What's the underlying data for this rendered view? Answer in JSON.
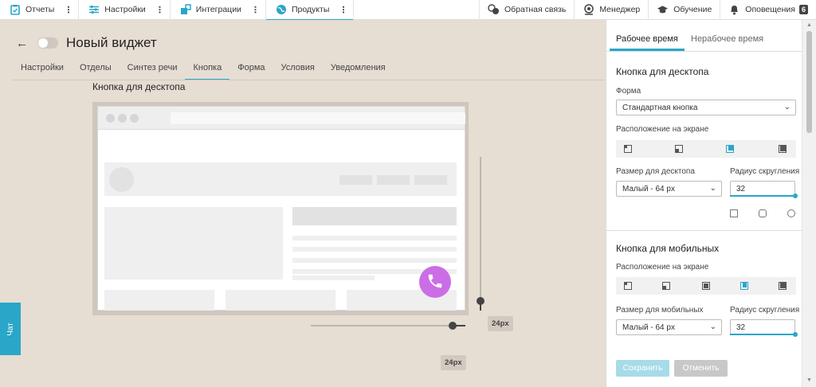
{
  "topnav": {
    "items": [
      {
        "label": "Отчеты",
        "icon": "clipboard-icon"
      },
      {
        "label": "Настройки",
        "icon": "sliders-icon"
      },
      {
        "label": "Интеграции",
        "icon": "puzzle-icon"
      },
      {
        "label": "Продукты",
        "icon": "globe-icon",
        "active": true
      }
    ],
    "right": [
      {
        "label": "Обратная связь",
        "icon": "feedback-icon"
      },
      {
        "label": "Менеджер",
        "icon": "manager-icon"
      },
      {
        "label": "Обучение",
        "icon": "graduation-cap-icon"
      },
      {
        "label": "Оповещения",
        "icon": "bell-icon",
        "badge": "6"
      }
    ],
    "accent_color": "#2aa6c8"
  },
  "header": {
    "back_icon": "←",
    "title": "Новый виджет"
  },
  "tabs": [
    "Настройки",
    "Отделы",
    "Синтез речи",
    "Кнопка",
    "Форма",
    "Условия",
    "Уведомления"
  ],
  "active_tab": "Кнопка",
  "preview": {
    "section_title": "Кнопка для десктопа",
    "vertical_offset": "24px",
    "horizontal_offset": "24px",
    "call_button_color": "#cb6ee6"
  },
  "chat_tab": {
    "label": "Чат"
  },
  "panel": {
    "tabs": [
      "Рабочее время",
      "Нерабочее время"
    ],
    "desktop": {
      "title": "Кнопка для десктопа",
      "shape_label": "Форма",
      "shape_value": "Стандартная кнопка",
      "position_label": "Расположение на экране",
      "size_label": "Размер для десктопа",
      "size_value": "Малый - 64 px",
      "radius_label": "Радиус скругления",
      "radius_value": "32"
    },
    "mobile": {
      "title": "Кнопка для мобильных",
      "position_label": "Расположение на экране",
      "size_label": "Размер для мобильных",
      "size_value": "Малый - 64 px",
      "radius_label": "Радиус скругления",
      "radius_value": "32"
    },
    "save_label": "Сохранить",
    "cancel_label": "Отменить"
  }
}
